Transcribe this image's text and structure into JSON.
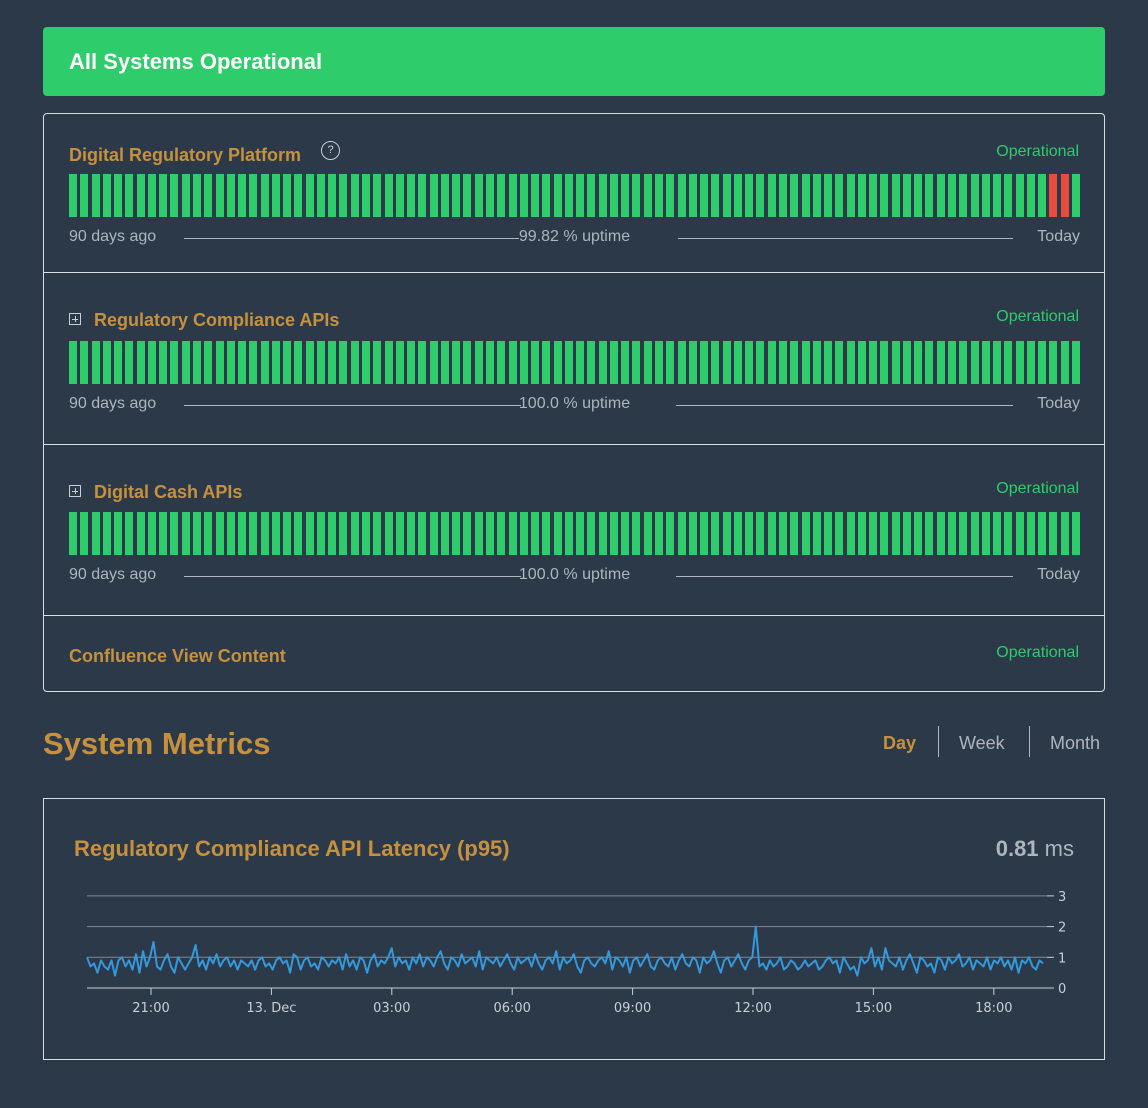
{
  "banner": {
    "text": "All Systems Operational"
  },
  "components": [
    {
      "name": "Digital Regulatory Platform",
      "status": "Operational",
      "help": "?",
      "has_uptime": true,
      "left_label": "90 days ago",
      "uptime": "99.82 % uptime",
      "right_label": "Today",
      "days": 90,
      "outage_days": [
        87,
        88
      ]
    },
    {
      "name": "Regulatory Compliance APIs",
      "status": "Operational",
      "expandable": true,
      "has_uptime": true,
      "left_label": "90 days ago",
      "uptime": "100.0 % uptime",
      "right_label": "Today",
      "days": 90,
      "outage_days": []
    },
    {
      "name": "Digital Cash APIs",
      "status": "Operational",
      "expandable": true,
      "has_uptime": true,
      "left_label": "90 days ago",
      "uptime": "100.0 % uptime",
      "right_label": "Today",
      "days": 90,
      "outage_days": []
    },
    {
      "name": "Confluence View Content",
      "status": "Operational",
      "has_uptime": false
    }
  ],
  "metrics": {
    "title": "System Metrics",
    "ranges": [
      "Day",
      "Week",
      "Month"
    ],
    "active_range": "Day",
    "card": {
      "name": "Regulatory Compliance API Latency (p95)",
      "value": "0.81",
      "unit": "ms"
    }
  },
  "colors": {
    "operational": "#2ecc6a",
    "outage": "#e74c3c",
    "accent": "#c6913e",
    "line": "#3498db"
  },
  "chart_data": {
    "type": "line",
    "title": "Regulatory Compliance API Latency (p95)",
    "xlabel": "",
    "ylabel": "",
    "x_ticks": [
      "21:00",
      "13. Dec",
      "03:00",
      "06:00",
      "09:00",
      "12:00",
      "15:00",
      "18:00"
    ],
    "y_ticks": [
      0,
      1,
      2,
      3
    ],
    "ylim": [
      0,
      3
    ],
    "grid": true,
    "x_start": "19:25",
    "x_end": "19:25",
    "series": [
      {
        "values": [
          1.0,
          0.7,
          0.8,
          0.5,
          0.9,
          0.7,
          0.6,
          0.9,
          0.4,
          0.9,
          1.0,
          0.7,
          0.9,
          0.6,
          1.1,
          0.5,
          1.2,
          0.7,
          1.0,
          1.5,
          0.7,
          0.6,
          0.9,
          1.1,
          0.7,
          0.5,
          1.0,
          0.8,
          0.6,
          0.8,
          1.0,
          1.4,
          0.7,
          0.9,
          0.6,
          1.0,
          0.8,
          1.1,
          0.7,
          0.9,
          1.0,
          0.7,
          0.9,
          0.6,
          0.9,
          0.8,
          0.7,
          0.9,
          0.6,
          0.9,
          1.0,
          0.7,
          0.8,
          0.6,
          0.9,
          1.0,
          0.8,
          0.9,
          0.5,
          1.1,
          1.0,
          0.6,
          0.9,
          1.0,
          0.7,
          0.8,
          0.6,
          1.0,
          0.9,
          0.7,
          0.9,
          0.8,
          1.0,
          0.6,
          1.1,
          0.7,
          0.9,
          0.6,
          1.0,
          0.9,
          0.5,
          0.9,
          1.1,
          0.7,
          0.9,
          0.8,
          1.0,
          1.3,
          0.7,
          1.0,
          0.8,
          0.9,
          0.6,
          1.0,
          0.8,
          1.1,
          0.7,
          1.0,
          0.9,
          0.7,
          1.0,
          1.2,
          0.8,
          0.6,
          1.0,
          0.9,
          0.7,
          1.1,
          0.8,
          0.9,
          1.0,
          0.7,
          1.2,
          0.6,
          1.0,
          0.9,
          0.8,
          1.0,
          0.7,
          0.9,
          1.1,
          0.8,
          0.6,
          1.0,
          0.8,
          0.9,
          1.0,
          0.7,
          1.1,
          0.8,
          0.6,
          0.9,
          1.0,
          0.8,
          1.2,
          0.6,
          1.0,
          0.8,
          0.9,
          1.1,
          0.7,
          0.5,
          0.9,
          1.0,
          0.8,
          0.7,
          0.9,
          1.0,
          0.8,
          1.2,
          0.6,
          1.0,
          0.9,
          0.7,
          1.0,
          0.5,
          0.9,
          1.0,
          0.7,
          0.9,
          1.1,
          0.7,
          0.6,
          0.9,
          1.0,
          0.8,
          0.7,
          1.0,
          0.6,
          0.9,
          1.1,
          0.8,
          0.7,
          1.0,
          0.9,
          0.5,
          1.0,
          0.8,
          0.9,
          1.2,
          0.8,
          0.5,
          0.9,
          1.0,
          0.7,
          0.9,
          1.1,
          0.8,
          0.6,
          0.9,
          1.0,
          2.0,
          0.7,
          0.8,
          0.6,
          0.9,
          0.7,
          0.8,
          1.0,
          0.6,
          0.7,
          0.9,
          0.8,
          0.6,
          0.7,
          0.9,
          0.7,
          0.8,
          0.9,
          0.6,
          0.7,
          0.9,
          1.0,
          0.8,
          0.9,
          0.5,
          1.0,
          0.8,
          0.6,
          0.7,
          0.4,
          1.0,
          0.8,
          0.9,
          1.3,
          0.7,
          1.0,
          0.6,
          1.3,
          0.9,
          0.8,
          0.7,
          1.0,
          0.6,
          0.9,
          1.1,
          0.8,
          0.5,
          1.0,
          0.9,
          0.7,
          0.8,
          0.5,
          1.0,
          0.9,
          0.6,
          1.0,
          0.8,
          0.9,
          1.1,
          0.7,
          0.8,
          1.0,
          0.6,
          0.9,
          0.8,
          0.7,
          1.0,
          0.6,
          0.9,
          0.8,
          1.0,
          0.7,
          0.9,
          0.6,
          1.0,
          0.5,
          0.9,
          0.8,
          1.0,
          0.7,
          0.6,
          0.9,
          0.8
        ]
      }
    ]
  }
}
